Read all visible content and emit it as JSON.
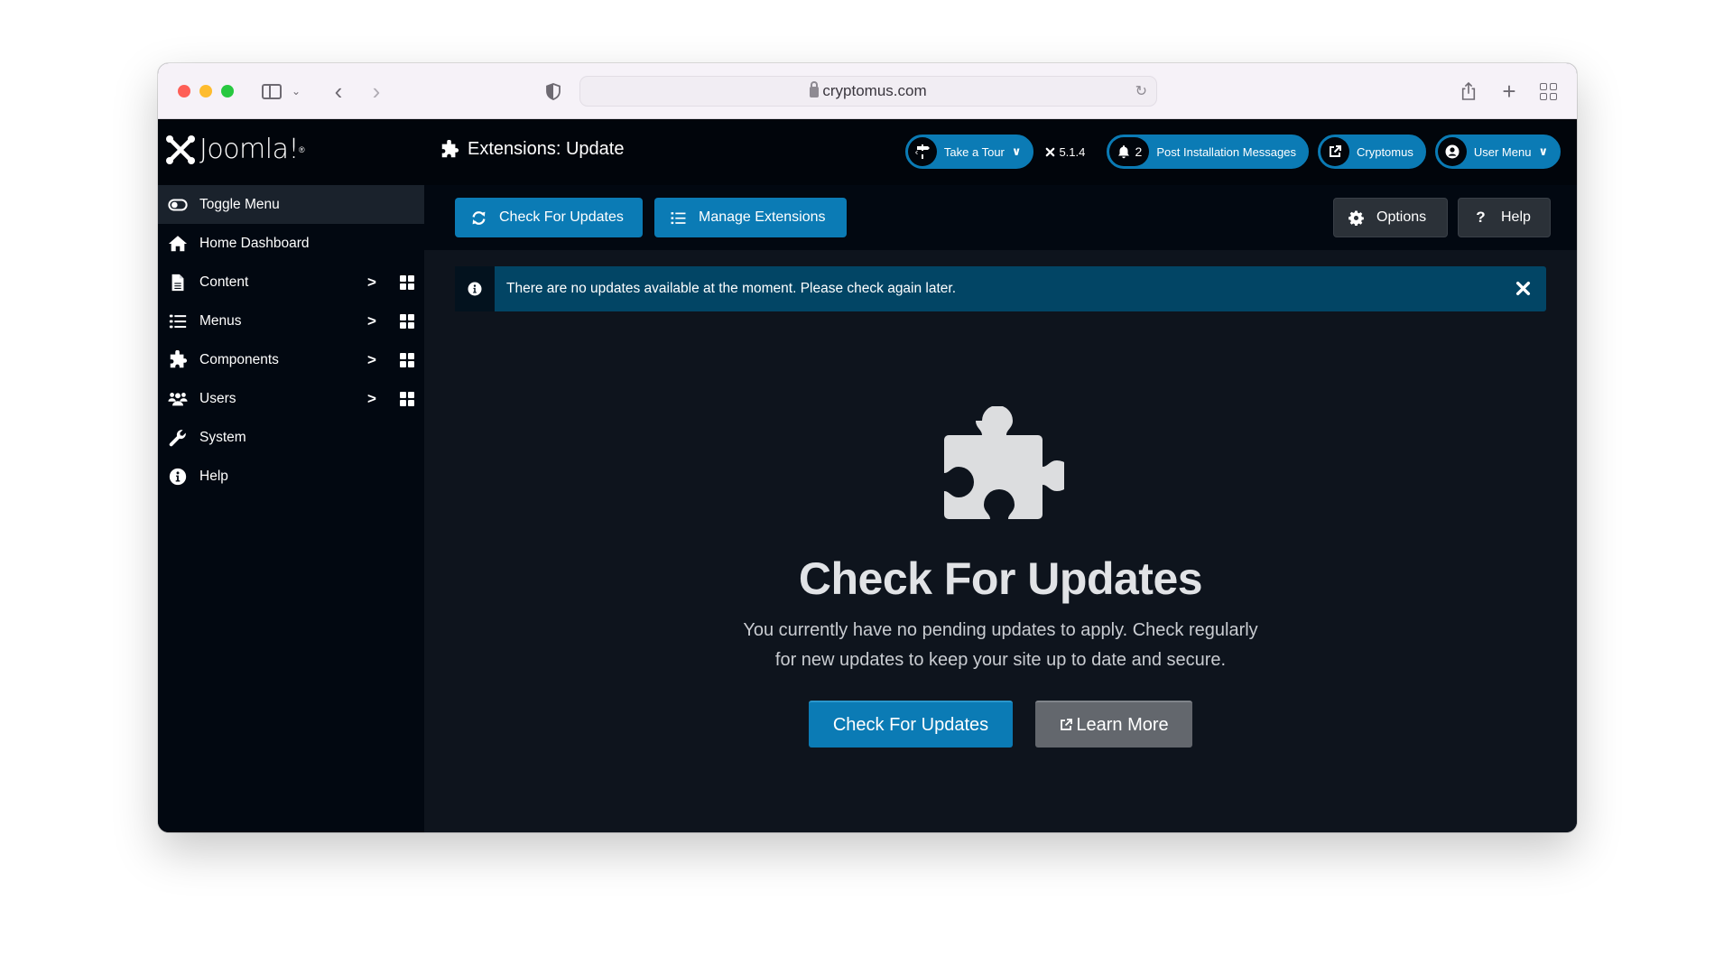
{
  "browser": {
    "url": "cryptomus.com"
  },
  "header": {
    "logo_text": "Joomla!",
    "page_title": "Extensions: Update",
    "take_tour_label": "Take a Tour",
    "version": "5.1.4",
    "notification_count": "2",
    "post_install_label": "Post Installation Messages",
    "site_label": "Cryptomus",
    "user_menu_label": "User Menu"
  },
  "sidebar": {
    "items": [
      {
        "label": "Toggle Menu",
        "icon": "toggle-icon"
      },
      {
        "label": "Home Dashboard",
        "icon": "home-icon"
      },
      {
        "label": "Content",
        "icon": "file-icon",
        "has_submenu": true
      },
      {
        "label": "Menus",
        "icon": "list-icon",
        "has_submenu": true
      },
      {
        "label": "Components",
        "icon": "puzzle-icon",
        "has_submenu": true
      },
      {
        "label": "Users",
        "icon": "users-icon",
        "has_submenu": true
      },
      {
        "label": "System",
        "icon": "wrench-icon"
      },
      {
        "label": "Help",
        "icon": "info-icon"
      }
    ]
  },
  "toolbar": {
    "check_updates_label": "Check For Updates",
    "manage_extensions_label": "Manage Extensions",
    "options_label": "Options",
    "help_label": "Help"
  },
  "alert": {
    "message": "There are no updates available at the moment. Please check again later."
  },
  "empty_state": {
    "title": "Check For Updates",
    "description_line1": "You currently have no pending updates to apply. Check regularly",
    "description_line2": "for new updates to keep your site up to date and secure.",
    "primary_button": "Check For Updates",
    "secondary_button": "Learn More"
  },
  "colors": {
    "accent": "#0b7bb5",
    "alert_bg": "#024565",
    "header_bg": "#01050b",
    "main_bg": "#0e141d"
  }
}
